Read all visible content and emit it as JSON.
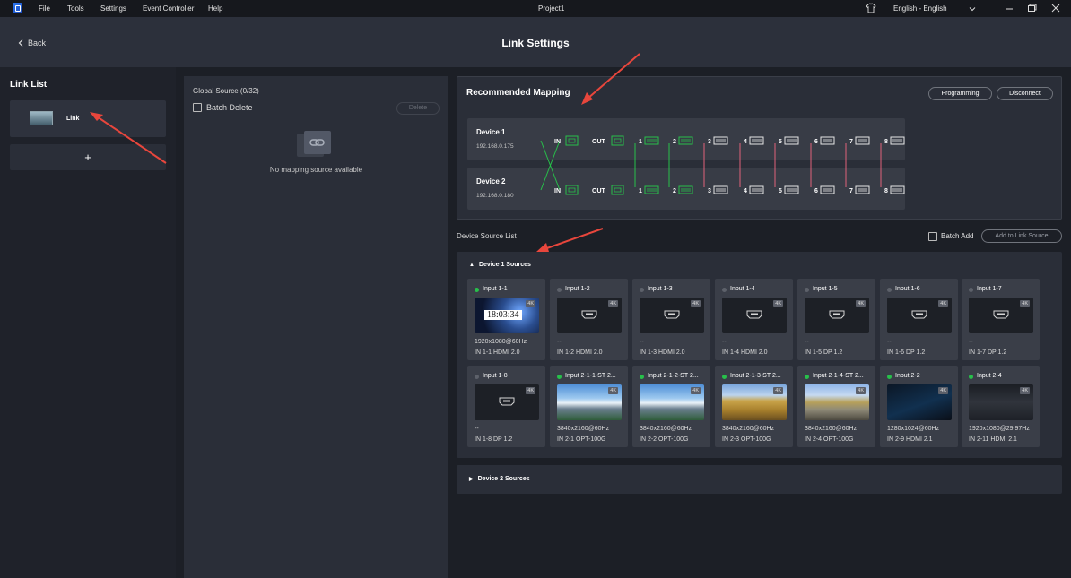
{
  "menubar": {
    "items": [
      "File",
      "Tools",
      "Settings",
      "Event Controller",
      "Help"
    ],
    "project_title": "Project1",
    "language": "English - English"
  },
  "header": {
    "back_label": "Back",
    "title": "Link Settings"
  },
  "link_list": {
    "title": "Link List",
    "items": [
      {
        "label": "Link"
      }
    ],
    "add_label": "+"
  },
  "global_source": {
    "title": "Global Source (0/32)",
    "batch_delete_label": "Batch Delete",
    "delete_label": "Delete",
    "empty_text": "No mapping source available"
  },
  "mapping": {
    "title": "Recommended Mapping",
    "programming_label": "Programming",
    "disconnect_label": "Disconnect",
    "devices": [
      {
        "name": "Device 1",
        "ip": "192.168.0.175"
      },
      {
        "name": "Device 2",
        "ip": "192.168.0.180"
      }
    ],
    "port_in_label": "IN",
    "port_out_label": "OUT",
    "output_numbers": [
      "1",
      "2",
      "3",
      "4",
      "5",
      "6",
      "7",
      "8"
    ],
    "colors": {
      "green": "#27c04a",
      "red": "#e0627a",
      "port": "#e6e6e6"
    }
  },
  "device_source": {
    "title": "Device Source List",
    "batch_add_label": "Batch Add",
    "add_button_label": "Add to Link Source",
    "device1_section": "Device 1 Sources",
    "device2_section": "Device 2 Sources",
    "badge": "4K",
    "preview_clock": "18:03:34",
    "sources": [
      {
        "title": "Input 1-1",
        "status": "active",
        "res": "1920x1080@60Hz",
        "port": "IN 1-1 HDMI 2.0",
        "preview": "clock"
      },
      {
        "title": "Input 1-2",
        "status": "idle",
        "res": "--",
        "port": "IN 1-2 HDMI 2.0",
        "preview": "none"
      },
      {
        "title": "Input 1-3",
        "status": "idle",
        "res": "--",
        "port": "IN 1-3 HDMI 2.0",
        "preview": "none"
      },
      {
        "title": "Input 1-4",
        "status": "idle",
        "res": "--",
        "port": "IN 1-4 HDMI 2.0",
        "preview": "none"
      },
      {
        "title": "Input 1-5",
        "status": "idle",
        "res": "--",
        "port": "IN 1-5 DP 1.2",
        "preview": "none"
      },
      {
        "title": "Input 1-6",
        "status": "idle",
        "res": "--",
        "port": "IN 1-6 DP 1.2",
        "preview": "none"
      },
      {
        "title": "Input 1-7",
        "status": "idle",
        "res": "--",
        "port": "IN 1-7 DP 1.2",
        "preview": "none"
      },
      {
        "title": "Input 1-8",
        "status": "idle",
        "res": "--",
        "port": "IN 1-8 DP 1.2",
        "preview": "none"
      },
      {
        "title": "Input 2-1-1-ST 2...",
        "status": "active",
        "res": "3840x2160@60Hz",
        "port": "IN 2-1 OPT-100G",
        "preview": "mountain"
      },
      {
        "title": "Input 2-1-2-ST 2...",
        "status": "active",
        "res": "3840x2160@60Hz",
        "port": "IN 2-2 OPT-100G",
        "preview": "mountain"
      },
      {
        "title": "Input 2-1-3-ST 2...",
        "status": "active",
        "res": "3840x2160@60Hz",
        "port": "IN 2-3 OPT-100G",
        "preview": "field"
      },
      {
        "title": "Input 2-1-4-ST 2...",
        "status": "active",
        "res": "3840x2160@60Hz",
        "port": "IN 2-4 OPT-100G",
        "preview": "road"
      },
      {
        "title": "Input 2-2",
        "status": "active",
        "res": "1280x1024@60Hz",
        "port": "IN 2-9 HDMI 2.1",
        "preview": "dark"
      },
      {
        "title": "Input 2-4",
        "status": "active",
        "res": "1920x1080@29.97Hz",
        "port": "IN 2-11 HDMI 2.1",
        "preview": "desktop"
      }
    ]
  }
}
